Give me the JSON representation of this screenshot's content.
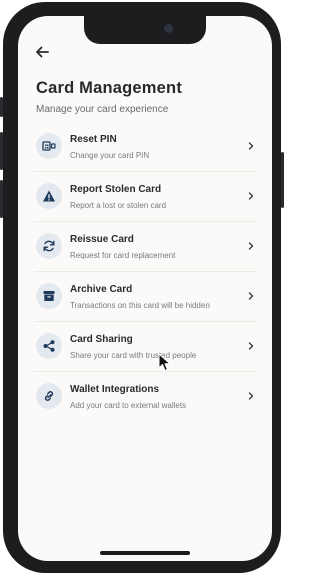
{
  "page": {
    "title": "Card Management",
    "subtitle": "Manage your card experience"
  },
  "icons": {
    "back": "arrow-left-icon",
    "chevron": "chevron-right-icon"
  },
  "colors": {
    "icon_bg": "#e4e9ef",
    "icon_fg": "#1f3a5a"
  },
  "items": [
    {
      "title": "Reset PIN",
      "subtitle": "Change your card PIN",
      "icon": "pin-keypad-icon"
    },
    {
      "title": "Report Stolen Card",
      "subtitle": "Report a lost or stolen card",
      "icon": "warning-icon"
    },
    {
      "title": "Reissue Card",
      "subtitle": "Request for card replacement",
      "icon": "refresh-icon"
    },
    {
      "title": "Archive Card",
      "subtitle": "Transactions on this card will be hidden",
      "icon": "archive-icon"
    },
    {
      "title": "Card Sharing",
      "subtitle": "Share your card with trusted people",
      "icon": "share-icon"
    },
    {
      "title": "Wallet Integrations",
      "subtitle": "Add your card to external wallets",
      "icon": "link-icon"
    }
  ]
}
